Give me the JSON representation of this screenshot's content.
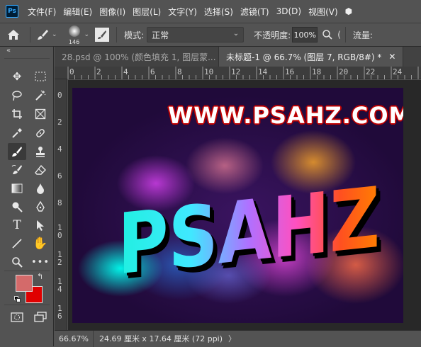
{
  "app": {
    "logo": "Ps"
  },
  "menu": [
    "文件(F)",
    "编辑(E)",
    "图像(I)",
    "图层(L)",
    "文字(Y)",
    "选择(S)",
    "滤镜(T)",
    "3D(D)",
    "视图(V)",
    "⬢"
  ],
  "options": {
    "brush_size": "146",
    "mode_label": "模式:",
    "mode_value": "正常",
    "opacity_label": "不透明度:",
    "opacity_value": "100%",
    "flow_label": "流量:"
  },
  "tabs": [
    {
      "label": "28.psd @ 100% (颜色填充 1, 图层蒙...",
      "active": false
    },
    {
      "label": "未标题-1 @ 66.7% (图层 7, RGB/8#) *",
      "active": true
    }
  ],
  "ruler_top": [
    "0",
    "2",
    "4",
    "6",
    "8",
    "10",
    "12",
    "14",
    "16",
    "18",
    "20",
    "22",
    "24"
  ],
  "ruler_left": [
    "0",
    "2",
    "4",
    "6",
    "8",
    "1\n0",
    "1\n2",
    "1\n4",
    "1\n6"
  ],
  "canvas": {
    "watermark": "WWW.PSAHZ.COM",
    "art_text": "PSAHZ"
  },
  "status": {
    "zoom": "66.67%",
    "doc_size": "24.69 厘米 x 17.64 厘米 (72 ppi)",
    "arrow": "〉"
  },
  "colors": {
    "foreground": "#d46a6a",
    "background": "#e00000"
  }
}
